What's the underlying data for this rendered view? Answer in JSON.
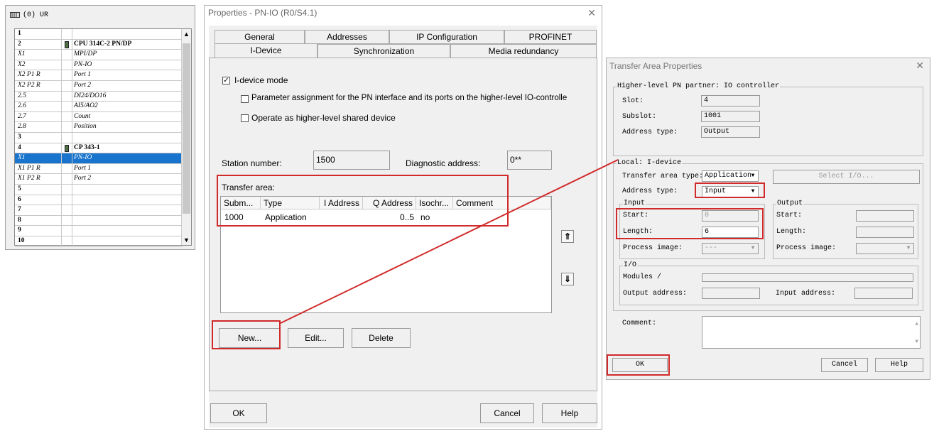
{
  "rack": {
    "title": "(0) UR",
    "rows": [
      {
        "slot": "1",
        "module": "",
        "bold": false,
        "icon": false,
        "selected": false
      },
      {
        "slot": "2",
        "module": "CPU 314C-2 PN/DP",
        "bold": true,
        "icon": true,
        "selected": false
      },
      {
        "slot": "X1",
        "module": "MPI/DP",
        "bold": false,
        "icon": false,
        "selected": false
      },
      {
        "slot": "X2",
        "module": "PN-IO",
        "bold": false,
        "icon": false,
        "selected": false
      },
      {
        "slot": "X2 P1 R",
        "module": "Port 1",
        "bold": false,
        "icon": false,
        "selected": false
      },
      {
        "slot": "X2 P2 R",
        "module": "Port 2",
        "bold": false,
        "icon": false,
        "selected": false
      },
      {
        "slot": "2.5",
        "module": "DI24/DO16",
        "bold": false,
        "icon": false,
        "selected": false
      },
      {
        "slot": "2.6",
        "module": "AI5/AO2",
        "bold": false,
        "icon": false,
        "selected": false
      },
      {
        "slot": "2.7",
        "module": "Count",
        "bold": false,
        "icon": false,
        "selected": false
      },
      {
        "slot": "2.8",
        "module": "Position",
        "bold": false,
        "icon": false,
        "selected": false
      },
      {
        "slot": "3",
        "module": "",
        "bold": false,
        "icon": false,
        "selected": false
      },
      {
        "slot": "4",
        "module": "CP 343-1",
        "bold": true,
        "icon": true,
        "selected": false
      },
      {
        "slot": "X1",
        "module": "PN-IO",
        "bold": false,
        "icon": false,
        "selected": true
      },
      {
        "slot": "X1 P1 R",
        "module": "Port 1",
        "bold": false,
        "icon": false,
        "selected": false
      },
      {
        "slot": "X1 P2 R",
        "module": "Port 2",
        "bold": false,
        "icon": false,
        "selected": false
      },
      {
        "slot": "5",
        "module": "",
        "bold": false,
        "icon": false,
        "selected": false
      },
      {
        "slot": "6",
        "module": "",
        "bold": false,
        "icon": false,
        "selected": false
      },
      {
        "slot": "7",
        "module": "",
        "bold": false,
        "icon": false,
        "selected": false
      },
      {
        "slot": "8",
        "module": "",
        "bold": false,
        "icon": false,
        "selected": false
      },
      {
        "slot": "9",
        "module": "",
        "bold": false,
        "icon": false,
        "selected": false
      },
      {
        "slot": "10",
        "module": "",
        "bold": false,
        "icon": false,
        "selected": false
      }
    ]
  },
  "props": {
    "title": "Properties - PN-IO (R0/S4.1)",
    "tabs_row1": [
      "General",
      "Addresses",
      "IP Configuration",
      "PROFINET"
    ],
    "tabs_row2": [
      "I-Device",
      "Synchronization",
      "Media redundancy"
    ],
    "active_tab": "I-Device",
    "idevice_mode": "I-device mode",
    "param_assign": "Parameter assignment for the PN interface and its ports on the higher-level IO-controlle",
    "shared_device": "Operate as higher-level shared device",
    "station_number_label": "Station number:",
    "station_number": "1500",
    "diag_address_label": "Diagnostic address:",
    "diag_address": "0**",
    "transfer_area_label": "Transfer area:",
    "columns": [
      "Subm...",
      "Type",
      "I Address",
      "Q Address",
      "Isochr...",
      "Comment"
    ],
    "rows": [
      {
        "subm": "1000",
        "type": "Application",
        "i_addr": "",
        "q_addr": "0..5",
        "isochr": "no",
        "comment": ""
      }
    ],
    "new_btn": "New...",
    "edit_btn": "Edit...",
    "delete_btn": "Delete",
    "ok_btn": "OK",
    "cancel_btn": "Cancel",
    "help_btn": "Help",
    "up_arrow": "⇑",
    "down_arrow": "⇓"
  },
  "tap": {
    "title": "Transfer Area Properties",
    "higher_group": "Higher-level  PN partner: IO controller",
    "slot_label": "Slot:",
    "slot": "4",
    "subslot_label": "Subslot:",
    "subslot": "1001",
    "addr_type_label": "Address type:",
    "addr_type_higher": "Output",
    "local_group": "Local: I-device",
    "ta_type_label": "Transfer area type:",
    "ta_type": "Application",
    "select_io_btn": "Select I/O...",
    "addr_type_local": "Input",
    "input_group": "Input",
    "start_label": "Start:",
    "start": "0",
    "length_label": "Length:",
    "length": "6",
    "process_image_label": "Process image:",
    "process_image": "---",
    "output_group": "Output",
    "out_start_label": "Start:",
    "out_length_label": "Length:",
    "out_process_image_label": "Process image:",
    "io_group": "I/O",
    "modules_label": "Modules /",
    "output_address_label": "Output address:",
    "input_address_label": "Input address:",
    "comment_label": "Comment:",
    "ok_btn": "OK",
    "cancel_btn": "Cancel",
    "help_btn": "Help"
  },
  "colors": {
    "highlight": "#d12a2a",
    "selection": "#1874cd"
  }
}
